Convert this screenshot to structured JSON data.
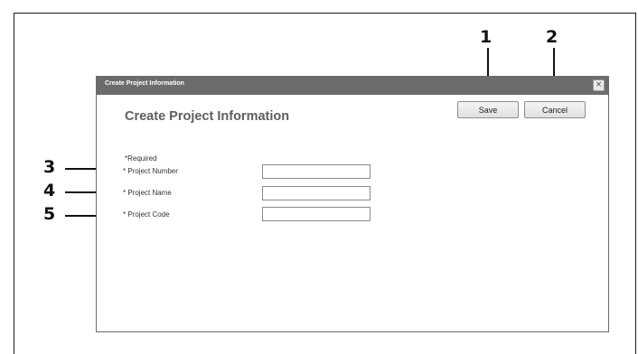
{
  "callouts": [
    "1",
    "2",
    "3",
    "4",
    "5"
  ],
  "dialog": {
    "titlebar_title": "Create Project Information",
    "close_glyph": "×",
    "heading": "Create Project Information",
    "save_label": "Save",
    "cancel_label": "Cancel",
    "required_note": "*Required",
    "fields": [
      {
        "label": "* Project Number",
        "value": ""
      },
      {
        "label": "* Project Name",
        "value": ""
      },
      {
        "label": "* Project Code",
        "value": ""
      }
    ]
  },
  "icons": {
    "close": "close-icon"
  },
  "colors": {
    "titlebar": "#6c6c6c",
    "heading": "#5e5e5e",
    "callout": "#111111"
  }
}
